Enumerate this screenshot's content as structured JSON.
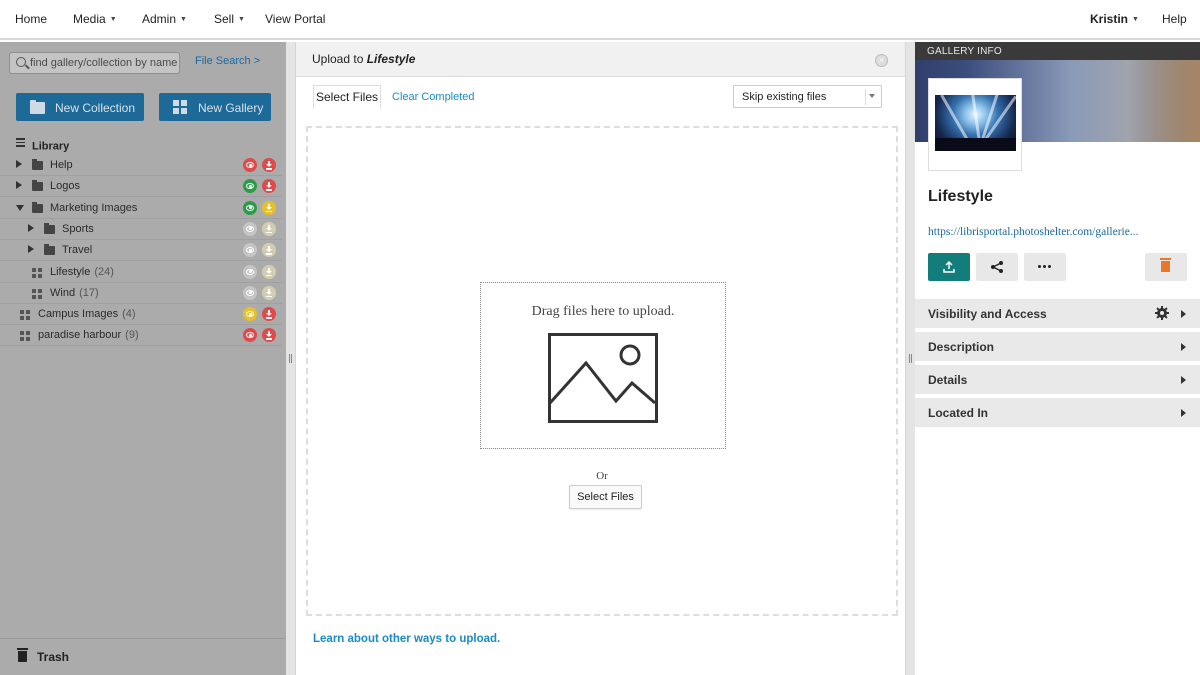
{
  "nav": {
    "home": "Home",
    "media": "Media",
    "admin": "Admin",
    "sell": "Sell",
    "view_portal": "View Portal",
    "user": "Kristin",
    "help": "Help"
  },
  "sidebar": {
    "search_placeholder": "find gallery/collection by name",
    "file_search": "File Search >",
    "new_collection": "New Collection",
    "new_gallery": "New Gallery",
    "library": "Library",
    "items": [
      {
        "label": "Help",
        "count": "",
        "type": "folder",
        "expand": "collapsed",
        "indent": 0,
        "visibility_color": "#e04a4a",
        "download_color": "#e04a4a"
      },
      {
        "label": "Logos",
        "count": "",
        "type": "folder",
        "expand": "collapsed",
        "indent": 0,
        "visibility_color": "#2e9b4a",
        "download_color": "#e04a4a"
      },
      {
        "label": "Marketing Images",
        "count": "",
        "type": "folder",
        "expand": "expanded",
        "indent": 0,
        "visibility_color": "#2e9b4a",
        "download_color": "#e8c02a"
      },
      {
        "label": "Sports",
        "count": "",
        "type": "folder",
        "expand": "collapsed",
        "indent": 1,
        "visibility_color": "#c5c5c5",
        "download_color": "#d2cdb0"
      },
      {
        "label": "Travel",
        "count": "",
        "type": "folder",
        "expand": "collapsed",
        "indent": 1,
        "visibility_color": "#c5c5c5",
        "download_color": "#d2cdb0"
      },
      {
        "label": "Lifestyle",
        "count": "(24)",
        "type": "gallery",
        "expand": "none",
        "indent": 1,
        "visibility_color": "#c5c5c5",
        "download_color": "#d2cdb0"
      },
      {
        "label": "Wind",
        "count": "(17)",
        "type": "gallery",
        "expand": "none",
        "indent": 1,
        "visibility_color": "#c5c5c5",
        "download_color": "#d2cdb0"
      },
      {
        "label": "Campus Images",
        "count": "(4)",
        "type": "gallery",
        "expand": "none",
        "indent": 0,
        "visibility_color": "#e8c02a",
        "download_color": "#e04a4a"
      },
      {
        "label": "paradise harbour",
        "count": "(9)",
        "type": "gallery",
        "expand": "none",
        "indent": 0,
        "visibility_color": "#e04a4a",
        "download_color": "#e04a4a"
      }
    ],
    "trash": "Trash"
  },
  "upload": {
    "title_prefix": "Upload to",
    "title_gallery": "Lifestyle",
    "select_files_tab": "Select Files",
    "clear_completed": "Clear Completed",
    "skip_option": "Skip existing files",
    "drag_text": "Drag files here to upload.",
    "or_text": "Or",
    "select_files_button": "Select Files",
    "learn_link": "Learn about other ways to upload."
  },
  "gallery_info": {
    "header": "GALLERY INFO",
    "name": "Lifestyle",
    "url": "https://librisportal.photoshelter.com/gallerie...",
    "sections": [
      "Visibility and Access",
      "Description",
      "Details",
      "Located In"
    ]
  },
  "colors": {
    "accent_blue": "#1d6a99",
    "link_blue": "#1a8ac8",
    "teal": "#137d7b",
    "delete_orange": "#e8762b"
  }
}
